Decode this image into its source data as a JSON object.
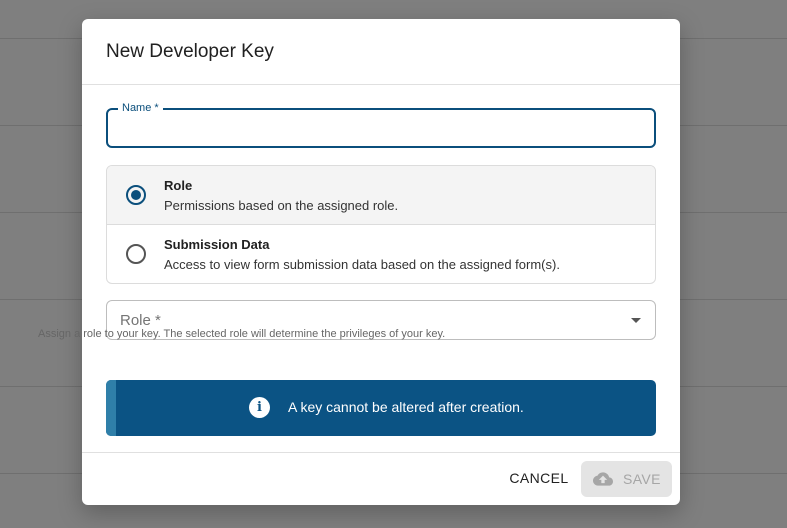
{
  "dialog": {
    "title": "New Developer Key",
    "name_field": {
      "label": "Name *",
      "value": "",
      "placeholder": ""
    },
    "key_type": {
      "options": [
        {
          "title": "Role",
          "description": "Permissions based on the assigned role.",
          "selected": true
        },
        {
          "title": "Submission Data",
          "description": "Access to view form submission data based on the assigned form(s).",
          "selected": false
        }
      ]
    },
    "role_select": {
      "placeholder": "Role *",
      "helper": "Assign a role to your key. The selected role will determine the privileges of your key."
    },
    "info_banner": {
      "icon": "info-icon",
      "text": "A key cannot be altered after creation."
    },
    "actions": {
      "cancel_label": "CANCEL",
      "save_label": "SAVE",
      "save_icon": "cloud-upload-icon",
      "save_disabled": true
    }
  },
  "colors": {
    "primary": "#0b4f7c",
    "banner": "#0b5384",
    "overlay": "#7f7f7f"
  }
}
